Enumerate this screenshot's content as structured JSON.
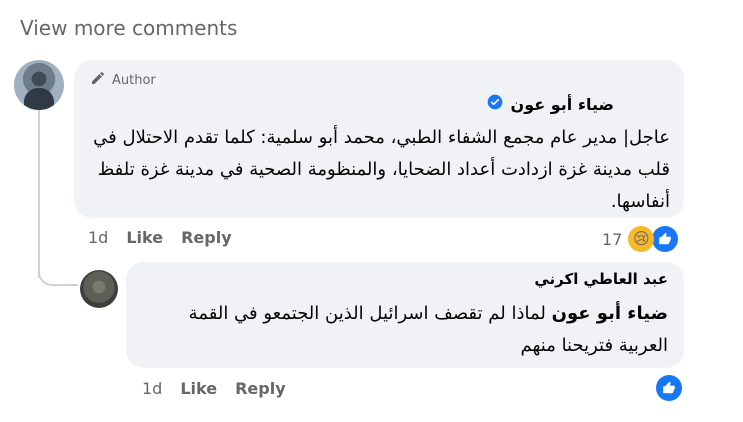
{
  "view_more": "View more comments",
  "main_comment": {
    "author_badge": "Author",
    "name": "ضياء أبو عون",
    "text": "عاجل| مدير عام مجمع الشفاء الطبي، محمد أبو سلمية: كلما تقدم الاحتلال في قلب مدينة غزة ازدادت أعداد الضحايا، والمنظومة الصحية في مدينة غزة تلفظ أنفاسها.",
    "time": "1d",
    "like_label": "Like",
    "reply_label": "Reply",
    "reaction_count": "17",
    "reaction_icons": [
      "sad-icon",
      "like-icon"
    ]
  },
  "reply_comment": {
    "name": "عبد العاطي اكرني",
    "mention": "ضياء أبو عون",
    "text": "لماذا لم تقصف اسرائيل الذين الجتمعو في القمة العربية فتريحنا منهم",
    "time": "1d",
    "like_label": "Like",
    "reply_label": "Reply",
    "reaction_icons": [
      "like-icon"
    ]
  },
  "colors": {
    "bubble": "#f0f2f5",
    "secondary_text": "#65676b",
    "like_blue": "#1877f2",
    "sad_yellow": "#f7b928"
  }
}
